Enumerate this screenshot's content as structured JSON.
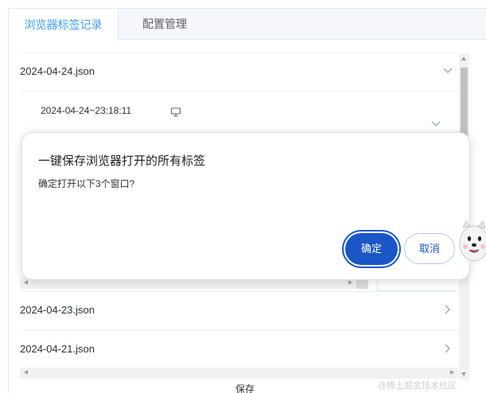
{
  "tabs": [
    {
      "label": "浏览器标签记录",
      "active": true
    },
    {
      "label": "配置管理",
      "active": false
    }
  ],
  "records": [
    {
      "label": "2024-04-24.json",
      "expanded": true
    },
    {
      "label": "2024-04-23.json",
      "expanded": false
    },
    {
      "label": "2024-04-21.json",
      "expanded": false
    }
  ],
  "sub_entry": {
    "timestamp": "2024-04-24~23:18:11",
    "icon": "monitor-icon"
  },
  "dialog": {
    "title": "一键保存浏览器打开的所有标签",
    "message": "确定打开以下3个窗口?",
    "confirm_label": "确定",
    "cancel_label": "取消"
  },
  "footer": {
    "save_label": "保存"
  },
  "watermark": "@稀土掘金技术社区",
  "colors": {
    "accent": "#409eff",
    "primary_button": "#1a56c6"
  }
}
